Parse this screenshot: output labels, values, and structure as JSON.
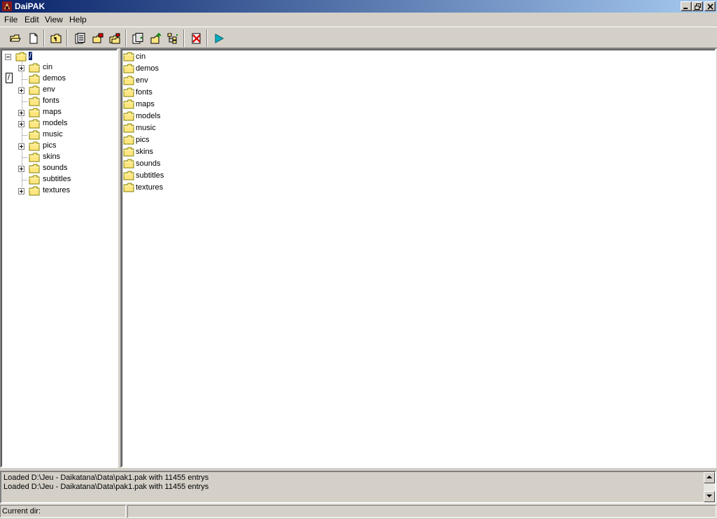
{
  "window": {
    "title": "DaiPAK"
  },
  "menu": [
    "File",
    "Edit",
    "View",
    "Help"
  ],
  "toolbar": {
    "icons": [
      "open-folder-icon",
      "new-file-icon",
      "up-folder-icon",
      "extract-icon",
      "add-file-icon",
      "add-folder-icon",
      "copy-icon",
      "export-icon",
      "tree-icon",
      "delete-icon",
      "run-icon"
    ]
  },
  "tree": {
    "root_label": "/",
    "items": [
      {
        "label": "cin",
        "expandable": true
      },
      {
        "label": "demos",
        "expandable": false
      },
      {
        "label": "env",
        "expandable": true
      },
      {
        "label": "fonts",
        "expandable": false
      },
      {
        "label": "maps",
        "expandable": true
      },
      {
        "label": "models",
        "expandable": true
      },
      {
        "label": "music",
        "expandable": false
      },
      {
        "label": "pics",
        "expandable": true
      },
      {
        "label": "skins",
        "expandable": false
      },
      {
        "label": "sounds",
        "expandable": true
      },
      {
        "label": "subtitles",
        "expandable": false
      },
      {
        "label": "textures",
        "expandable": true
      }
    ],
    "edit_box_value": "/"
  },
  "list": {
    "items": [
      "cin",
      "demos",
      "env",
      "fonts",
      "maps",
      "models",
      "music",
      "pics",
      "skins",
      "sounds",
      "subtitles",
      "textures"
    ]
  },
  "log": {
    "lines": [
      "Loaded D:\\Jeu - Daikatana\\Data\\pak1.pak with 11455 entrys",
      "Loaded D:\\Jeu - Daikatana\\Data\\pak1.pak with 11455 entrys"
    ]
  },
  "status": {
    "current_dir_label": "Current dir:",
    "current_dir_value": ""
  },
  "colors": {
    "titlebar_start": "#0a246a",
    "titlebar_end": "#a6caf0",
    "folder": "#ffe680",
    "face": "#d4d0c8"
  }
}
